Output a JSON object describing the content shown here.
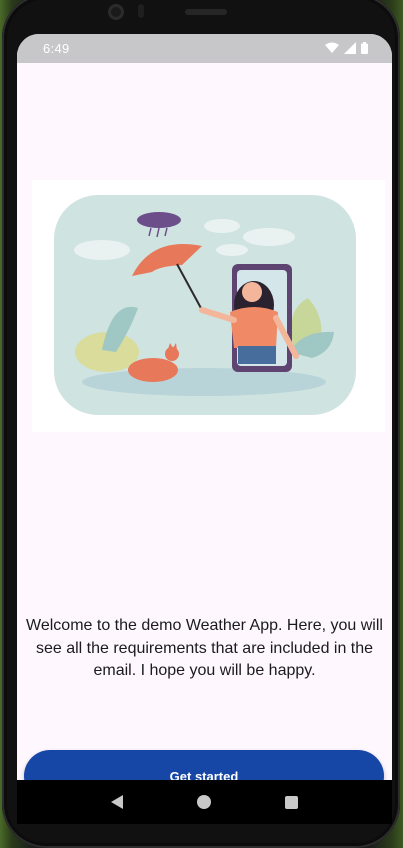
{
  "status_bar": {
    "time": "6:49",
    "icons": [
      "wifi-icon",
      "signal-icon",
      "battery-icon"
    ]
  },
  "onboarding": {
    "illustration": "woman-with-umbrella-emerging-from-phone-with-sleeping-cat-illustration",
    "welcome_text": "Welcome to the demo Weather App. Here, you will see all the requirements that are included in the email. I hope you will be happy.",
    "button_label": "Get started"
  },
  "navigation_bar": {
    "buttons": [
      "back-icon",
      "home-icon",
      "recents-icon"
    ]
  },
  "colors": {
    "primary_button": "#1646a6",
    "screen_background": "#fef7fe",
    "status_bar": "#c7c7c9"
  }
}
